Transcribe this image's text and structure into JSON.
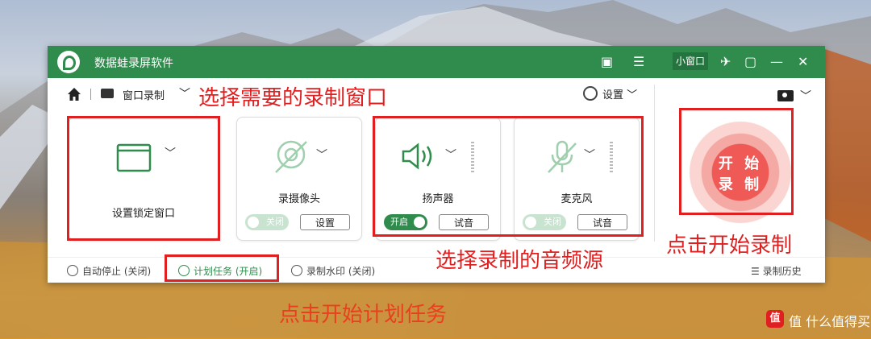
{
  "window": {
    "title": "数据蛙录屏软件",
    "small_window_label": "小窗口"
  },
  "toolbar": {
    "mode_label": "窗口录制",
    "settings_label": "设置"
  },
  "cards": {
    "window_lock": {
      "label": "设置锁定窗口"
    },
    "camera": {
      "label": "录摄像头",
      "toggle": "关闭",
      "button": "设置"
    },
    "speaker": {
      "label": "扬声器",
      "toggle": "开启",
      "button": "试音"
    },
    "microphone": {
      "label": "麦克风",
      "toggle": "关闭",
      "button": "试音"
    }
  },
  "record_button": {
    "line1": "开 始",
    "line2": "录 制"
  },
  "bottom_bar": {
    "auto_stop": "自动停止 (关闭)",
    "scheduled_task": "计划任务 (开启)",
    "watermark": "录制水印 (关闭)",
    "history": "录制历史"
  },
  "annotations": {
    "select_window": "选择需要的录制窗口",
    "select_audio": "选择录制的音频源",
    "click_start": "点击开始录制",
    "click_schedule": "点击开始计划任务"
  },
  "watermark_text": "值 什么值得买",
  "colors": {
    "brand_green": "#2f8c4d",
    "annotation_red": "#e02020",
    "record_red": "#f05a56"
  }
}
